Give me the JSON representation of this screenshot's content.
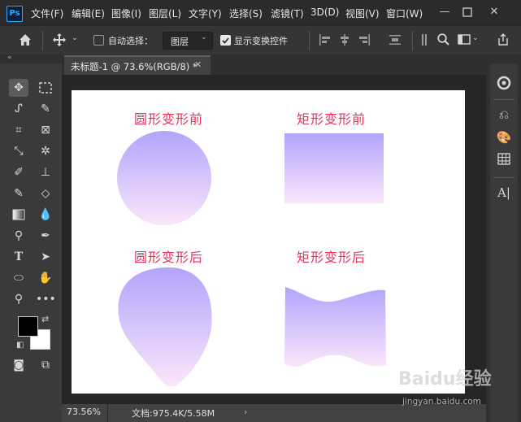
{
  "app": {
    "logo_text": "Ps"
  },
  "menu": [
    "文件(F)",
    "编辑(E)",
    "图像(I)",
    "图层(L)",
    "文字(Y)",
    "选择(S)",
    "滤镜(T)",
    "3D(D)",
    "视图(V)",
    "窗口(W)"
  ],
  "window_controls": [
    "minimize-icon",
    "restore-icon",
    "close-icon"
  ],
  "options_bar": {
    "auto_select_label": "自动选择：",
    "auto_select_checked": false,
    "layer_dropdown_value": "图层",
    "show_transform_label": "显示变换控件",
    "show_transform_checked": true
  },
  "document_tab": {
    "title": "未标题-1 @ 73.6%(RGB/8) *"
  },
  "canvas": {
    "gradient_top": "#b3a4fb",
    "gradient_bottom": "#fbe6fb",
    "caption_color": "#e8325b",
    "captions": {
      "circle_before": "圆形变形前",
      "rect_before": "矩形变形前",
      "circle_after": "圆形变形后",
      "rect_after": "矩形变形后"
    }
  },
  "status_bar": {
    "zoom": "73.56%",
    "doc_info": "文档:975.4K/5.58M"
  },
  "colors": {
    "foreground": "#000000",
    "background": "#ffffff"
  },
  "watermark": {
    "logo": "Baidu经验",
    "url": "jingyan.baidu.com"
  }
}
